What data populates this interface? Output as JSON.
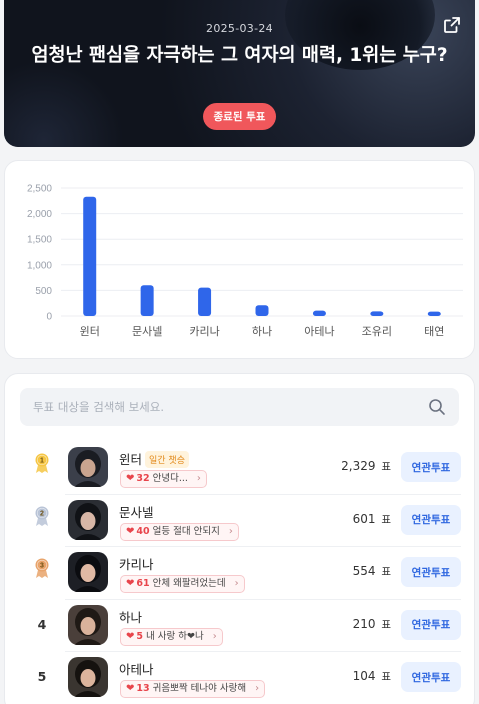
{
  "hero": {
    "date": "2025-03-24",
    "title": "엄청난 팬심을 자극하는 그 여자의 매력, 1위는 누구?",
    "status_badge": "종료된 투표",
    "share_icon": "external-link-icon"
  },
  "chart_data": {
    "type": "bar",
    "categories": [
      "윈터",
      "문사넬",
      "카리나",
      "하나",
      "아테나",
      "조유리",
      "태연"
    ],
    "values": [
      2329,
      601,
      554,
      210,
      104,
      90,
      85
    ],
    "ylim": [
      0,
      2500
    ],
    "yticks": [
      "0",
      "500",
      "1,000",
      "1,500",
      "2,000",
      "2,500"
    ],
    "bar_color": "#2f66ea",
    "grid": true
  },
  "search": {
    "placeholder": "투표 대상을 검색해 보세요."
  },
  "candidates": [
    {
      "rank": "1",
      "name": "윈터",
      "tag": "일간 챗승",
      "comment_count": "32",
      "comment": "안녕다...",
      "votes": "2,329",
      "unit": "표",
      "button": "연관투표"
    },
    {
      "rank": "2",
      "name": "문사넬",
      "tag": "",
      "comment_count": "40",
      "comment": "얼등 절대 안되지",
      "votes": "601",
      "unit": "표",
      "button": "연관투표"
    },
    {
      "rank": "3",
      "name": "카리나",
      "tag": "",
      "comment_count": "61",
      "comment": "안체 왜팔려었는데",
      "votes": "554",
      "unit": "표",
      "button": "연관투표"
    },
    {
      "rank": "4",
      "name": "하나",
      "tag": "",
      "comment_count": "5",
      "comment": "내 사랑 하❤나",
      "votes": "210",
      "unit": "표",
      "button": "연관투표"
    },
    {
      "rank": "5",
      "name": "아테나",
      "tag": "",
      "comment_count": "13",
      "comment": "귀음뽀짝 테나야 사랑해",
      "votes": "104",
      "unit": "표",
      "button": "연관투표"
    }
  ],
  "colors": {
    "accent": "#2f67e0",
    "badge": "#f0575b",
    "gold": "#f5c542",
    "silver": "#b8c3d6",
    "bronze": "#e8a36a"
  }
}
